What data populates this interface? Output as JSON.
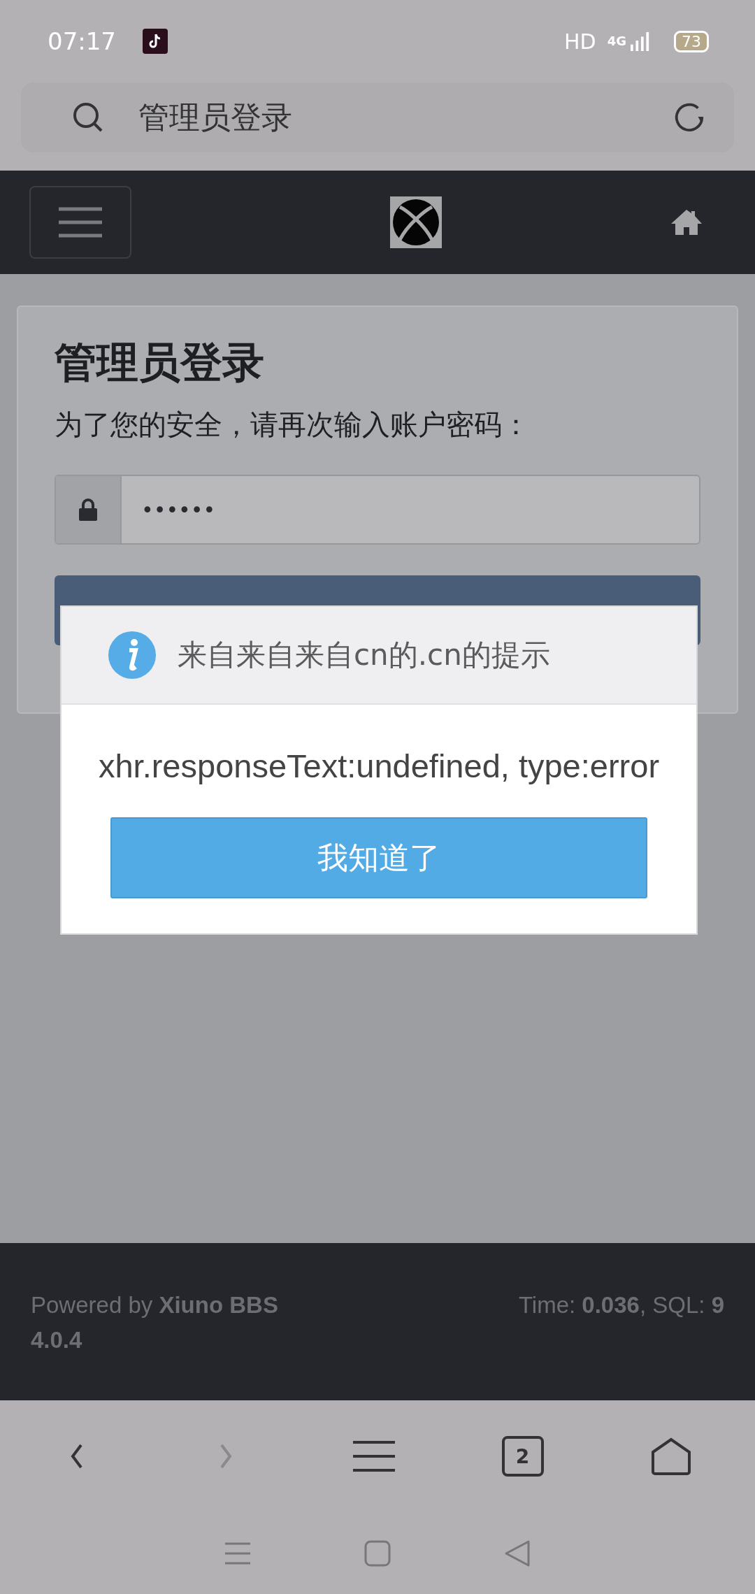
{
  "status_bar": {
    "time": "07:17",
    "network_label": "HD",
    "network_type": "4G",
    "battery": "73"
  },
  "address_bar": {
    "title": "管理员登录"
  },
  "login_card": {
    "title": "管理员登录",
    "subtitle": "为了您的安全，请再次输入账户密码：",
    "password": "••••••"
  },
  "dialog": {
    "title": "来自来自来自cn的.cn的提示",
    "message": "xhr.responseText:undefined, type:error",
    "button": "我知道了"
  },
  "footer": {
    "powered": "Powered by **Xiuno BBS 4.0.4**",
    "stats": "Time: **0.036**, SQL: **9**"
  },
  "browser_nav": {
    "tab_count": "2"
  }
}
